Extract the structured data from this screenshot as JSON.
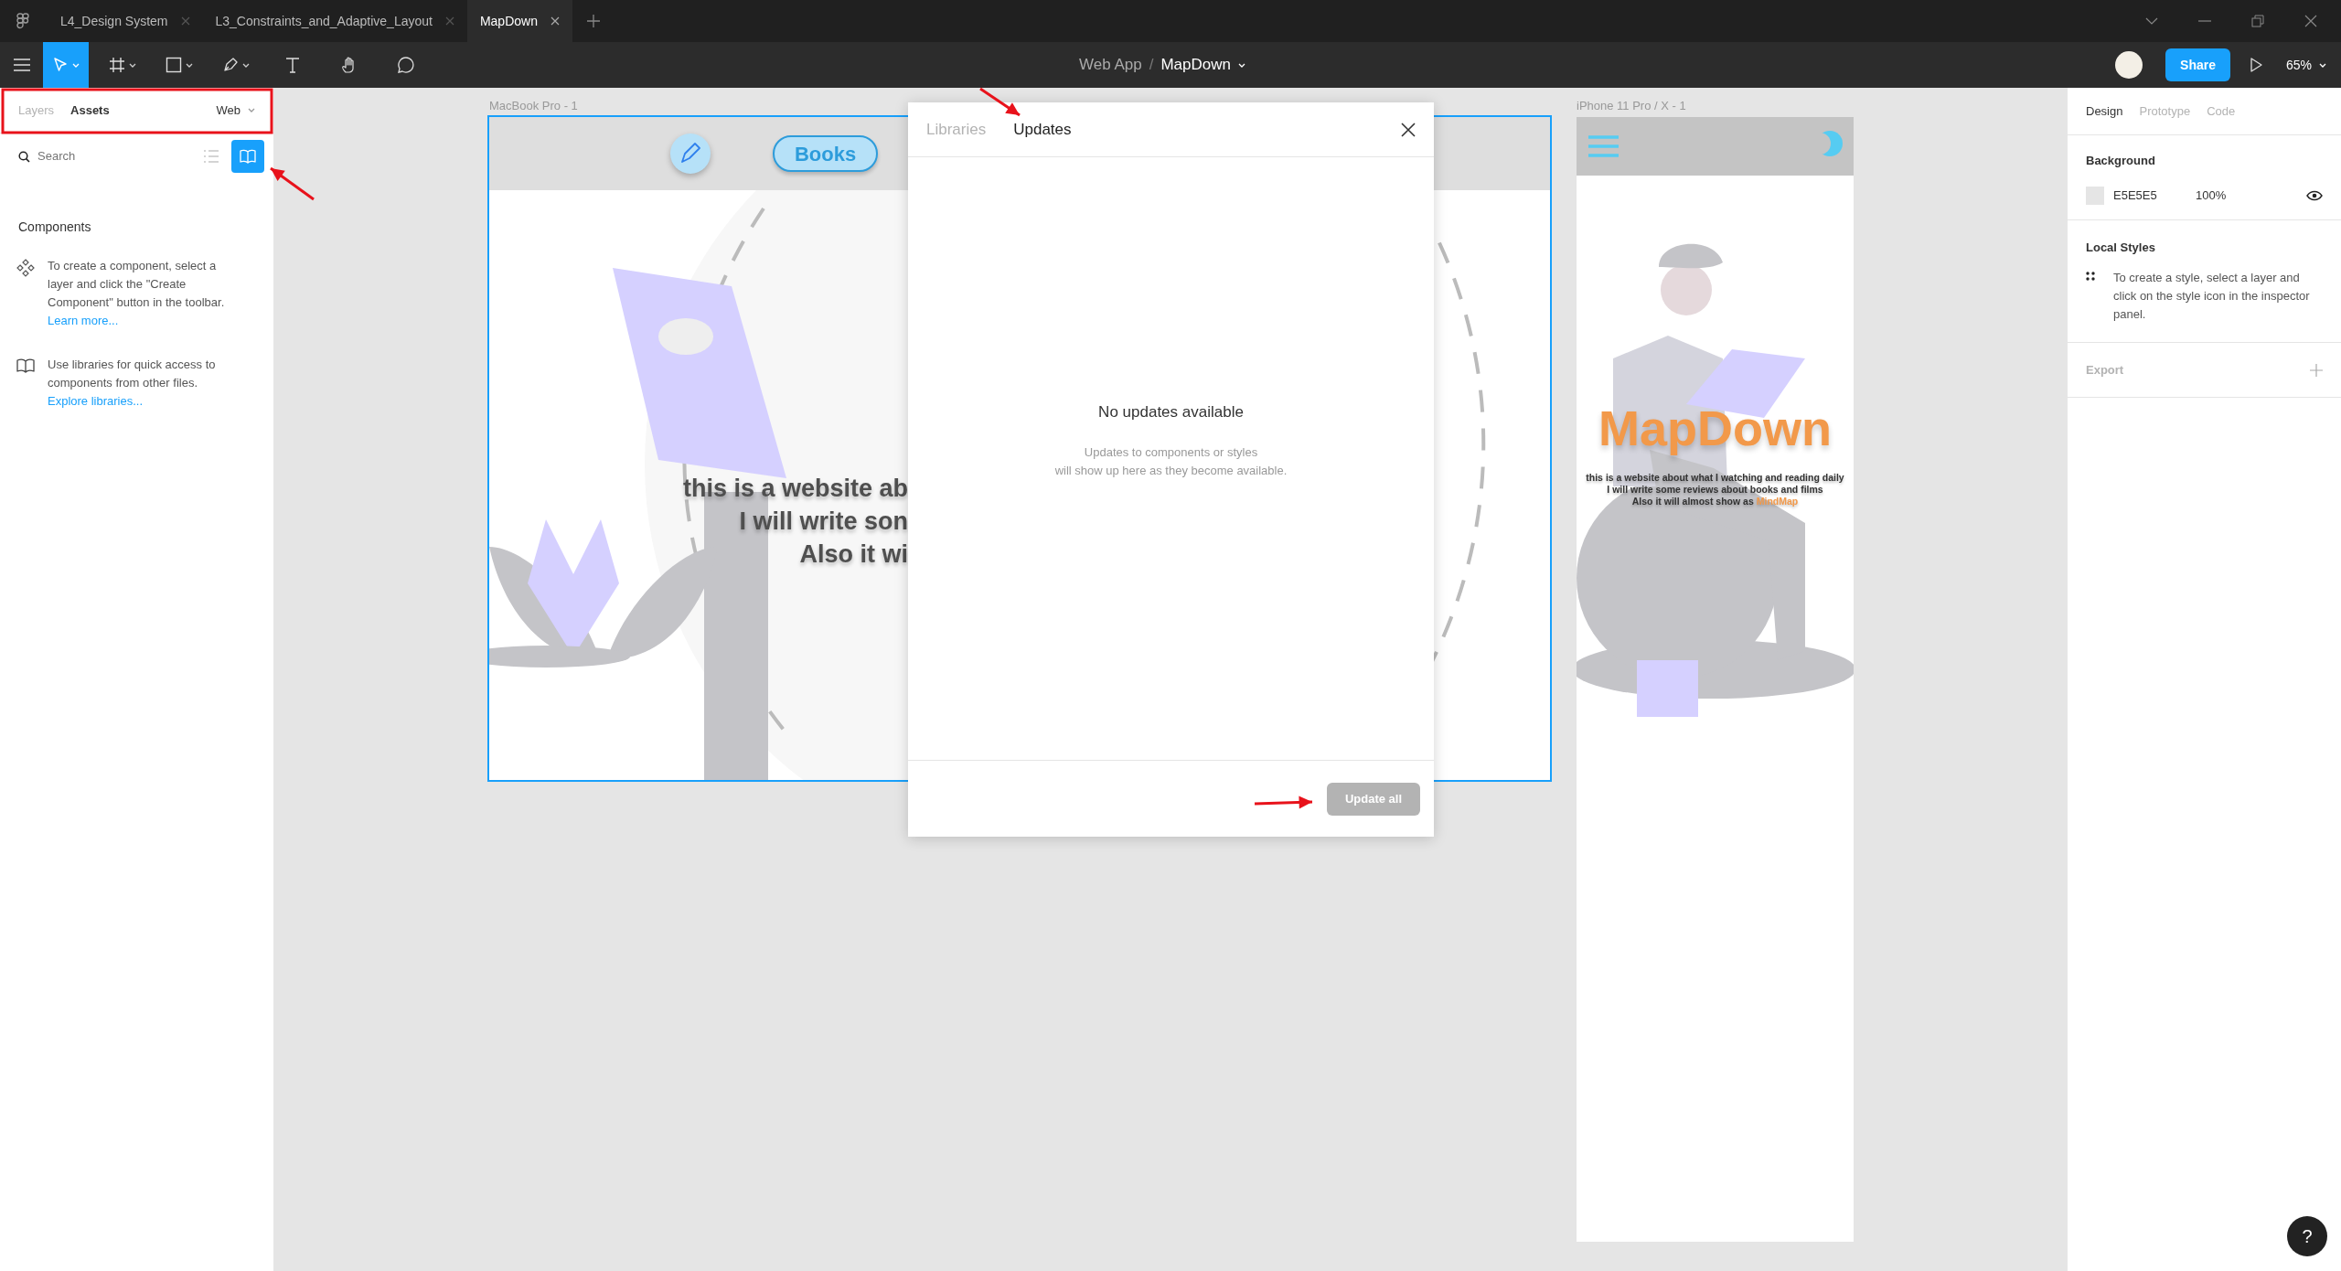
{
  "tabs": [
    {
      "label": "L4_Design System",
      "selected": false
    },
    {
      "label": "L3_Constraints_and_Adaptive_Layout",
      "selected": false
    },
    {
      "label": "MapDown",
      "selected": true
    }
  ],
  "toolbar": {
    "tools": [
      {
        "kind": "move",
        "selected": true
      },
      {
        "kind": "frame",
        "selected": false
      },
      {
        "kind": "shape",
        "selected": false
      },
      {
        "kind": "pen",
        "selected": false
      },
      {
        "kind": "text",
        "selected": false
      },
      {
        "kind": "hand",
        "selected": false
      },
      {
        "kind": "comment",
        "selected": false
      }
    ],
    "breadcrumb": {
      "project": "Web App",
      "separator": "/",
      "file": "MapDown"
    },
    "share": "Share",
    "zoom": "65%"
  },
  "left_panel": {
    "tabs": [
      {
        "label": "Layers",
        "selected": false
      },
      {
        "label": "Assets",
        "selected": true
      }
    ],
    "page": "Web",
    "search": {
      "placeholder": "Search"
    },
    "view_modes": [
      {
        "kind": "list",
        "selected": false
      },
      {
        "kind": "library",
        "selected": true
      }
    ],
    "section": "Components",
    "hints": [
      {
        "kind": "component",
        "text": "To create a component, select a layer and click the \"Create Component\" button in the toolbar.",
        "link": "Learn more..."
      },
      {
        "kind": "library",
        "text": "Use libraries for quick access to components from other files.",
        "link": "Explore libraries..."
      }
    ]
  },
  "desktop_frame": {
    "label": "MacBook Pro - 1",
    "selected": true,
    "nav_button": "Books",
    "tagline": [
      "this is a website ab",
      "I will write son",
      "Also it wi"
    ]
  },
  "mobile_frame": {
    "label": "iPhone 11 Pro / X - 1",
    "selected": false,
    "title": "MapDown",
    "tagline": [
      "this is a website about what I watching and reading daily",
      "I will write some reviews about books and films",
      "Also it will almost show as"
    ],
    "highlight": "MindMap"
  },
  "dialog": {
    "tabs": [
      {
        "label": "Libraries",
        "selected": false
      },
      {
        "label": "Updates",
        "selected": true
      }
    ],
    "empty_title": "No updates available",
    "empty_text": [
      "Updates to components or styles",
      "will show up here as they become available."
    ],
    "button": {
      "label": "Update all",
      "disabled": true
    }
  },
  "right_panel": {
    "tabs": [
      {
        "label": "Design",
        "selected": true
      },
      {
        "label": "Prototype",
        "selected": false
      },
      {
        "label": "Code",
        "selected": false
      }
    ],
    "background": {
      "label": "Background",
      "hex": "E5E5E5",
      "opacity": "100%",
      "visible": true
    },
    "local_styles": {
      "label": "Local Styles",
      "hint": "To create a style, select a layer and click on the style icon in the inspector panel."
    },
    "export": {
      "label": "Export"
    }
  },
  "help": "?"
}
